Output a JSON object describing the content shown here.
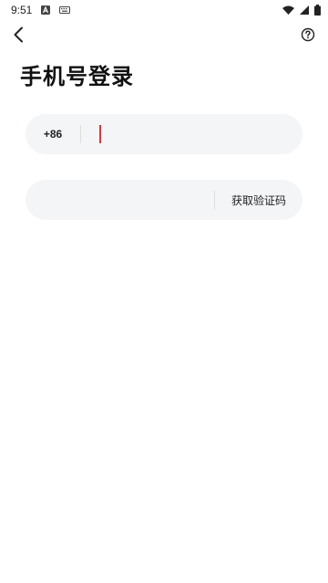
{
  "status_bar": {
    "time": "9:51",
    "icons": [
      "a-notification-icon",
      "keyboard-icon",
      "wifi-icon",
      "signal-icon",
      "battery-icon"
    ]
  },
  "nav": {
    "back_icon": "chevron-left-icon",
    "help_icon": "help-circle-icon"
  },
  "page": {
    "title": "手机号登录"
  },
  "phone_field": {
    "country_code": "+86",
    "value": "",
    "placeholder": "",
    "cursor_color": "#e0353f"
  },
  "code_field": {
    "value": "",
    "placeholder": "",
    "get_code_label": "获取验证码"
  },
  "colors": {
    "field_bg": "#f4f5f7",
    "accent": "#e0353f",
    "text": "#111111"
  }
}
